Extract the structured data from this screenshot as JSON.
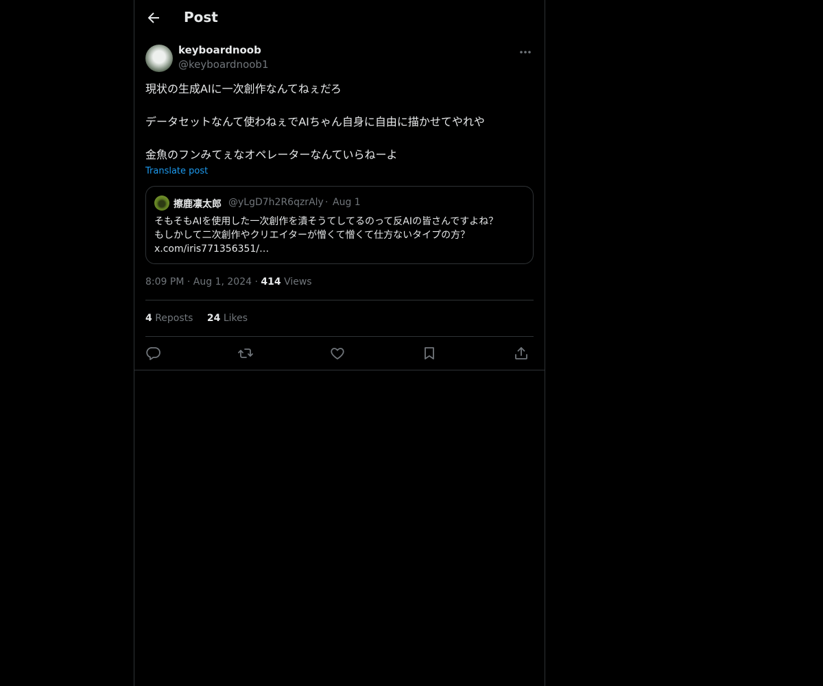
{
  "header": {
    "title": "Post"
  },
  "post": {
    "author_name": "keyboardnoob",
    "author_handle": "@keyboardnoob1",
    "lines": [
      "現状の生成AIに一次創作なんてねぇだろ",
      "データセットなんて使わねぇでAIちゃん自身に自由に描かせてやれや",
      "金魚のフンみてぇなオペレーターなんていらねーよ"
    ],
    "translate_label": "Translate post",
    "time": "8:09 PM",
    "date": "Aug 1, 2024",
    "views_count": "414",
    "views_label": "Views"
  },
  "quote": {
    "author_name": "擦鹿凛太郎",
    "author_handle": "@yLgD7h2R6qzrAly",
    "date": "Aug 1",
    "lines": [
      "そもそもAIを使用した一次創作を潰そうてしてるのって反AIの皆さんですよね？",
      "もしかして二次創作やクリエイターが憎くて憎くて仕方ないタイプの方？",
      "x.com/iris771356351/…"
    ]
  },
  "stats": {
    "reposts_count": "4",
    "reposts_label": "Reposts",
    "likes_count": "24",
    "likes_label": "Likes"
  },
  "icons": [
    "back-arrow-icon",
    "more-icon",
    "reply-icon",
    "repost-icon",
    "like-icon",
    "bookmark-icon",
    "share-icon"
  ],
  "colors": {
    "background": "#000000",
    "text": "#e7e9ea",
    "muted": "#71767b",
    "link": "#1d9bf0",
    "border": "#2f3336"
  }
}
